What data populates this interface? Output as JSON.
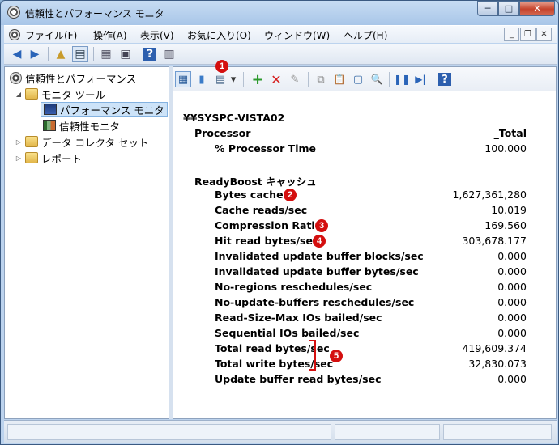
{
  "window": {
    "title": "信頼性とパフォーマンス モニタ"
  },
  "caption": {
    "minimize": "─",
    "maximize": "□",
    "close": "✕"
  },
  "menu": {
    "items": [
      "ファイル(F)",
      "操作(A)",
      "表示(V)",
      "お気に入り(O)",
      "ウィンドウ(W)",
      "ヘルプ(H)"
    ],
    "mdi": {
      "minimize": "_",
      "restore": "❐",
      "close": "✕"
    }
  },
  "toolbar": {
    "back": "◀",
    "forward": "▶",
    "up": "▲",
    "show_tree": "▤",
    "properties": "▦",
    "print": "▣",
    "help": "?",
    "console": "▥"
  },
  "tree": {
    "root": "信頼性とパフォーマンス",
    "monitor_tools": "モニタ ツール",
    "perf_monitor": "パフォーマンス モニタ",
    "reliability_monitor": "信頼性モニタ",
    "data_collector_sets": "データ コレクタ セット",
    "reports": "レポート"
  },
  "content_toolbar": {
    "view_graph": "▦",
    "view_histogram": "▮",
    "view_report": "▤",
    "dropdown": "▾",
    "add": "+",
    "delete": "✕",
    "highlight": "✎",
    "copy": "⧉",
    "paste": "📋",
    "properties": "▢",
    "zoom": "🔍",
    "freeze": "❚❚",
    "update": "▶|",
    "help": "?"
  },
  "report": {
    "computer": "¥¥SYSPC-VISTA02",
    "processor": {
      "object": "Processor",
      "instance": "_Total",
      "counters": [
        {
          "name": "% Processor Time",
          "value": "100.000"
        }
      ]
    },
    "readyboost": {
      "object": "ReadyBoost キャッシュ",
      "counters": [
        {
          "name": "Bytes cached",
          "value": "1,627,361,280"
        },
        {
          "name": "Cache reads/sec",
          "value": "10.019"
        },
        {
          "name": "Compression Ratio",
          "value": "169.560"
        },
        {
          "name": "Hit read bytes/sec",
          "value": "303,678.177"
        },
        {
          "name": "Invalidated update buffer blocks/sec",
          "value": "0.000"
        },
        {
          "name": "Invalidated update buffer bytes/sec",
          "value": "0.000"
        },
        {
          "name": "No-regions reschedules/sec",
          "value": "0.000"
        },
        {
          "name": "No-update-buffers reschedules/sec",
          "value": "0.000"
        },
        {
          "name": "Read-Size-Max IOs bailed/sec",
          "value": "0.000"
        },
        {
          "name": "Sequential IOs bailed/sec",
          "value": "0.000"
        },
        {
          "name": "Total read bytes/sec",
          "value": "419,609.374"
        },
        {
          "name": "Total write bytes/sec",
          "value": "32,830.073"
        },
        {
          "name": "Update buffer read bytes/sec",
          "value": "0.000"
        }
      ]
    }
  },
  "callouts": [
    "1",
    "2",
    "3",
    "4",
    "5"
  ],
  "colors": {
    "callout": "#d40f0f",
    "selection": "#cde3f8"
  }
}
